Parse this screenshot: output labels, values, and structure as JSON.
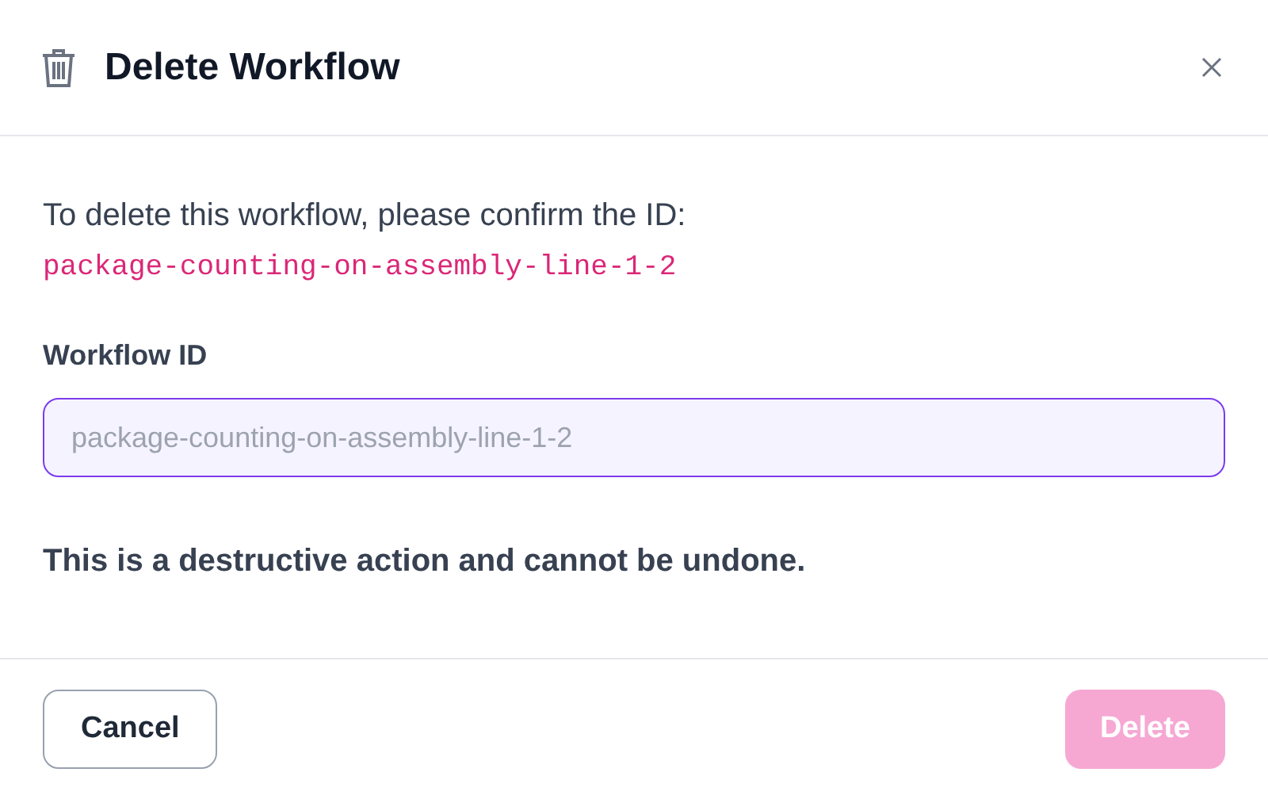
{
  "dialog": {
    "title": "Delete Workflow",
    "message": "To delete this workflow, please confirm the ID:",
    "workflow_id": "package-counting-on-assembly-line-1-2",
    "field": {
      "label": "Workflow ID",
      "placeholder": "package-counting-on-assembly-line-1-2",
      "focused": true
    },
    "warning": "This is a destructive action and cannot be undone.",
    "buttons": [
      {
        "kind": "secondary",
        "label": "Cancel",
        "disabled": false
      },
      {
        "kind": "danger",
        "label": "Delete",
        "disabled": true
      }
    ]
  }
}
